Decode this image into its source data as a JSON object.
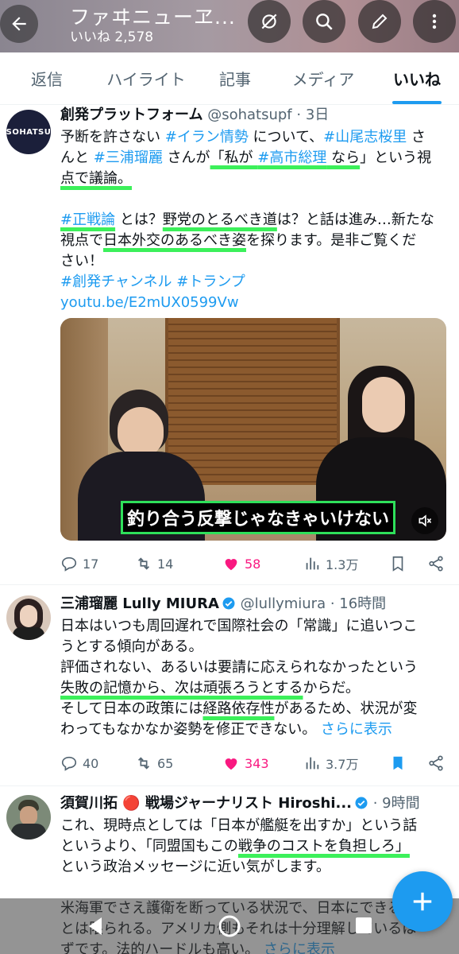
{
  "header": {
    "title": "ファヰニューヱ...",
    "likes": "いいね 2,578"
  },
  "tabs": [
    "返信",
    "ハイライト",
    "記事",
    "メディア",
    "いいね"
  ],
  "posts": [
    {
      "name": "創発プラットフォーム",
      "handle": "@sohatsupf",
      "time": "· 3日",
      "avatar_text": "SOHATSU",
      "body": [
        [
          {
            "t": "予断を許さない "
          },
          {
            "t": "#イラン情勢",
            "c": "link"
          },
          {
            "t": " について、"
          },
          {
            "t": "#山尾志桜里",
            "c": "link"
          },
          {
            "t": " さ"
          }
        ],
        [
          {
            "t": "んと "
          },
          {
            "t": "#三浦瑠麗",
            "c": "link"
          },
          {
            "t": " さんが"
          },
          {
            "t": "「私が ",
            "c": "hl"
          },
          {
            "t": "#高市総理",
            "c": "link hl"
          },
          {
            "t": " なら",
            "c": "hl"
          },
          {
            "t": "」という視"
          }
        ],
        [
          {
            "t": "点で議論。",
            "c": "hl"
          }
        ],
        [
          {
            "t": " "
          }
        ],
        [
          {
            "t": "#正戦論",
            "c": "link hl"
          },
          {
            "t": " とは？"
          },
          {
            "t": "野党のとるべき道",
            "c": "hl"
          },
          {
            "t": "は？と話は進み…新たな"
          }
        ],
        [
          {
            "t": "視点で"
          },
          {
            "t": "日本外交のあるべき姿",
            "c": "hl"
          },
          {
            "t": "を探ります。是非ご覧くだ"
          }
        ],
        [
          {
            "t": "さい！"
          }
        ],
        [
          {
            "t": "#創発チャンネル #トランプ",
            "c": "link"
          }
        ],
        [
          {
            "t": "youtu.be/E2mUX0599Vw",
            "c": "link"
          }
        ]
      ],
      "video_caption": "釣り合う反撃じゃなきゃいけない",
      "replies": "17",
      "reposts": "14",
      "likes": "58",
      "views": "1.3万"
    },
    {
      "name": "三浦瑠麗 Lully MIURA",
      "handle": "@lullymiura",
      "time": "· 16時間",
      "body": [
        [
          {
            "t": "日本はいつも周回遅れで国際社会の「常識」に追いつこ"
          }
        ],
        [
          {
            "t": "うとする傾向がある。"
          }
        ],
        [
          {
            "t": "評価されない、あるいは要請に応えられなかったという"
          }
        ],
        [
          {
            "t": "失敗の記憶から、次は頑張ろうとする",
            "c": "hl"
          },
          {
            "t": "からだ。"
          }
        ],
        [
          {
            "t": "そして日本の政策には"
          },
          {
            "t": "経路依存性",
            "c": "hl"
          },
          {
            "t": "があるため、状況が変"
          }
        ],
        [
          {
            "t": "わってもなかなか姿勢を修正できない。 "
          },
          {
            "t": "さらに表示",
            "c": "link"
          }
        ]
      ],
      "replies": "40",
      "reposts": "65",
      "likes": "343",
      "views": "3.7万"
    },
    {
      "name": "須賀川拓 🔴 戦場ジャーナリスト Hiroshi...",
      "handle": "",
      "time": "· 9時間",
      "body": [
        [
          {
            "t": "これ、現時点としては「日本が艦艇を出すか」という話"
          }
        ],
        [
          {
            "t": "というより、「同盟国もこの"
          },
          {
            "t": "戦争のコストを負担しろ」",
            "c": "hl"
          }
        ],
        [
          {
            "t": "という政治メッセージに近い気がします。"
          }
        ],
        [
          {
            "t": " "
          }
        ],
        [
          {
            "t": "米海軍でさえ護衛を断っている状況で、日本にできるこ"
          }
        ],
        [
          {
            "t": "とは限られる。アメリカ側もそれは十分理解しているは"
          }
        ],
        [
          {
            "t": "ずです。法的ハードルも高い。 "
          },
          {
            "t": "さらに表示",
            "c": "link"
          }
        ]
      ]
    }
  ],
  "colors": {
    "accent": "#1d9bf0",
    "like": "#f91880",
    "highlight": "#3cf05a"
  }
}
